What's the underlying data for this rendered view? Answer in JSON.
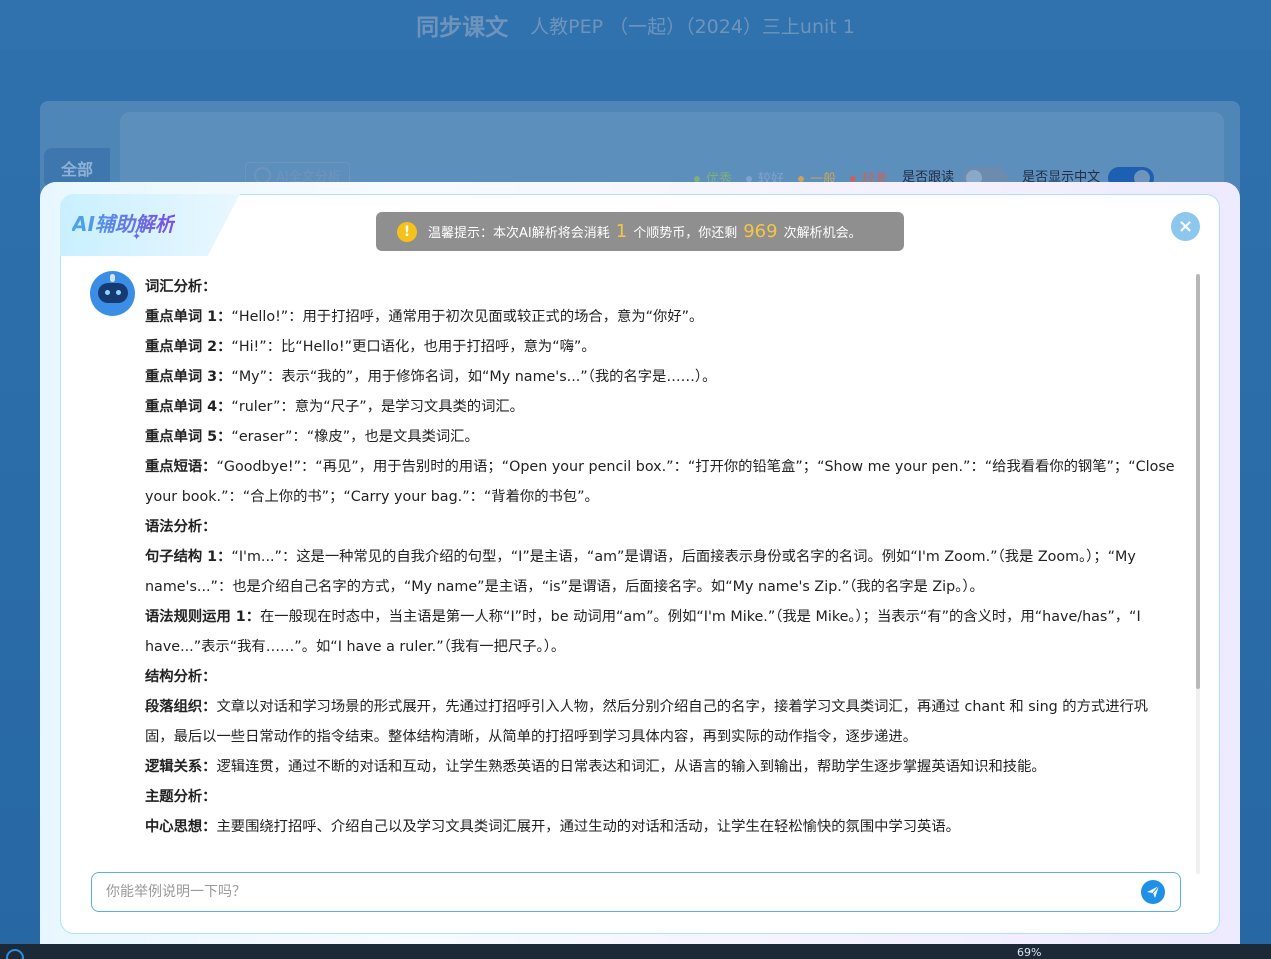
{
  "background": {
    "header_title": "同步课文",
    "header_subtitle": "人教PEP （一起）（2024）三上unit 1",
    "tab_all": "全部",
    "ai_full_text_button": "AI全文分析",
    "legend": [
      {
        "label": "优秀",
        "color": "#7bb07a"
      },
      {
        "label": "较好",
        "color": "#7fa3d0"
      },
      {
        "label": "一般",
        "color": "#c9a35a"
      },
      {
        "label": "较差",
        "color": "#c9635a"
      }
    ],
    "follow_read_label": "是否跟读",
    "show_chinese_label": "是否显示中文"
  },
  "modal": {
    "title": "AI辅助解析",
    "tip": {
      "prefix": "温馨提示：本次AI解析将会消耗",
      "cost": "1",
      "middle": "个顺势币，你还剩",
      "remaining": "969",
      "suffix": "次解析机会。"
    },
    "close_label": "×",
    "ask_placeholder": "你能举例说明一下吗？"
  },
  "analysis": [
    {
      "label": "词汇分析：",
      "text": ""
    },
    {
      "label": "重点单词 1：",
      "text": "“Hello!”：用于打招呼，通常用于初次见面或较正式的场合，意为“你好”。"
    },
    {
      "label": "重点单词 2：",
      "text": "“Hi!”：比“Hello!”更口语化，也用于打招呼，意为“嗨”。"
    },
    {
      "label": "重点单词 3：",
      "text": "“My”：表示“我的”，用于修饰名词，如“My name's...”（我的名字是……）。"
    },
    {
      "label": "重点单词 4：",
      "text": "“ruler”：意为“尺子”，是学习文具类的词汇。"
    },
    {
      "label": "重点单词 5：",
      "text": "“eraser”：“橡皮”，也是文具类词汇。"
    },
    {
      "label": "重点短语：",
      "text": "“Goodbye!”：“再见”，用于告别时的用语；“Open your pencil box.”：“打开你的铅笔盒”；“Show me your pen.”：“给我看看你的钢笔”；“Close your book.”：“合上你的书”；“Carry your bag.”：“背着你的书包”。"
    },
    {
      "label": "语法分析：",
      "text": ""
    },
    {
      "label": "句子结构 1：",
      "text": "“I'm...”：这是一种常见的自我介绍的句型，“I”是主语，“am”是谓语，后面接表示身份或名字的名词。例如“I'm Zoom.”（我是 Zoom。）；“My name's...”：也是介绍自己名字的方式，“My name”是主语，“is”是谓语，后面接名字。如“My name's Zip.”（我的名字是 Zip。）。"
    },
    {
      "label": "语法规则运用 1：",
      "text": "在一般现在时态中，当主语是第一人称“I”时，be 动词用“am”。例如“I'm Mike.”（我是 Mike。）；当表示“有”的含义时，用“have/has”，“I have...”表示“我有……”。如“I have a ruler.”（我有一把尺子。）。"
    },
    {
      "label": "结构分析：",
      "text": ""
    },
    {
      "label": "段落组织：",
      "text": "文章以对话和学习场景的形式展开，先通过打招呼引入人物，然后分别介绍自己的名字，接着学习文具类词汇，再通过 chant 和 sing 的方式进行巩固，最后以一些日常动作的指令结束。整体结构清晰，从简单的打招呼到学习具体内容，再到实际的动作指令，逐步递进。"
    },
    {
      "label": "逻辑关系：",
      "text": "逻辑连贯，通过不断的对话和互动，让学生熟悉英语的日常表达和词汇，从语言的输入到输出，帮助学生逐步掌握英语知识和技能。"
    },
    {
      "label": "主题分析：",
      "text": ""
    },
    {
      "label": "中心思想：",
      "text": "主要围绕打招呼、介绍自己以及学习文具类词汇展开，通过生动的对话和活动，让学生在轻松愉快的氛围中学习英语。"
    }
  ],
  "taskbar": {
    "battery_percent": "69%"
  }
}
